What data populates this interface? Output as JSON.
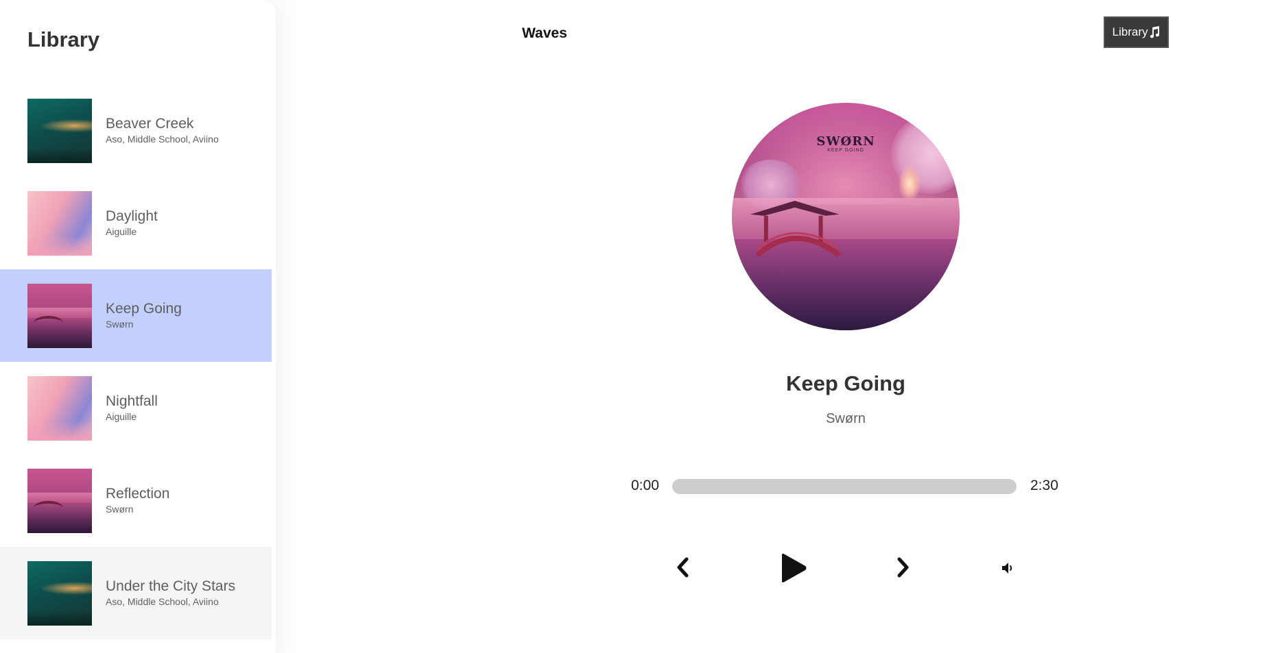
{
  "sidebar": {
    "title": "Library",
    "songs": [
      {
        "name": "Beaver Creek",
        "artist": "Aso, Middle School, Aviino",
        "cover": "forest-art",
        "state": "normal"
      },
      {
        "name": "Daylight",
        "artist": "Aiguille",
        "cover": "daylight-art",
        "state": "normal"
      },
      {
        "name": "Keep Going",
        "artist": "Swørn",
        "cover": "sworn-art",
        "state": "selected"
      },
      {
        "name": "Nightfall",
        "artist": "Aiguille",
        "cover": "daylight-art",
        "state": "normal"
      },
      {
        "name": "Reflection",
        "artist": "Swørn",
        "cover": "sworn-art",
        "state": "normal"
      },
      {
        "name": "Under the City Stars",
        "artist": "Aso, Middle School, Aviino",
        "cover": "forest-art",
        "state": "hovered"
      }
    ],
    "selected_color": "#c3cffd",
    "hover_color": "#f5f5f5"
  },
  "header": {
    "brand": "Waves",
    "library_button_label": "Library",
    "library_button_icon": "music-note-icon"
  },
  "player": {
    "cover_logo": "SWØRN",
    "cover_logo_sub": "KEEP GOING",
    "title": "Keep Going",
    "artist": "Swørn",
    "current_time": "0:00",
    "total_time": "2:30",
    "progress": 0,
    "controls": {
      "prev_icon": "chevron-left-icon",
      "play_icon": "play-icon",
      "next_icon": "chevron-right-icon",
      "volume_icon": "volume-icon"
    }
  }
}
